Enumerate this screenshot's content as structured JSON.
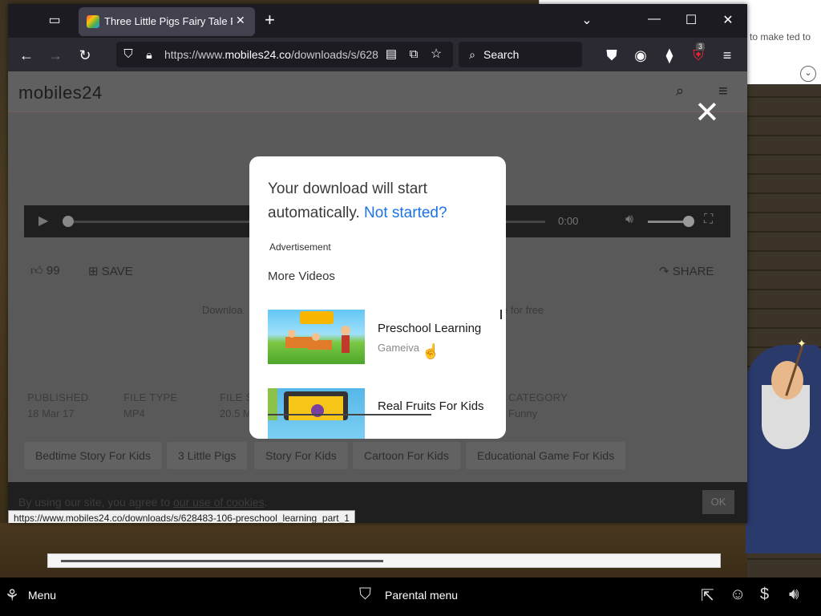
{
  "browser": {
    "tab_title": "Three Little Pigs Fairy Tale Free",
    "url_prefix": "https://www.",
    "url_domain": "mobiles24.co",
    "url_path": "/downloads/s/628",
    "search_placeholder": "Search",
    "extension_badge": "3"
  },
  "notification": {
    "text": "to make ted to"
  },
  "site": {
    "logo": "mobiles24",
    "player_time": "0:00",
    "likes": "99",
    "save_label": "SAVE",
    "share_label": "SHARE",
    "download_left": "Downloa",
    "download_right": "e for free",
    "meta": [
      {
        "key": "PUBLISHED",
        "value": "18 Mar 17"
      },
      {
        "key": "FILE TYPE",
        "value": "MP4"
      },
      {
        "key": "FILE S",
        "value": "20.5 M"
      },
      {
        "key": "CATEGORY",
        "value": "Funny"
      }
    ],
    "tags": [
      "Bedtime Story For Kids",
      "3 Little Pigs",
      "Story For Kids",
      "Cartoon For Kids",
      "Educational Game For Kids"
    ],
    "cookie_text": "By using our site, you agree to ",
    "cookie_link": "our use of cookies",
    "cookie_suffix": ".",
    "cookie_ok": "OK",
    "status_url": "https://www.mobiles24.co/downloads/s/628483-106-preschool_learning_part_1"
  },
  "modal": {
    "message": "Your download will start automatically.",
    "link": "Not started?",
    "ad_label": "Advertisement",
    "more_videos": "More Videos",
    "videos": [
      {
        "title": "Preschool Learning",
        "channel": "Gameiva"
      },
      {
        "title": "Real Fruits For Kids",
        "channel": ""
      }
    ]
  },
  "taskbar": {
    "menu": "Menu",
    "parental": "Parental menu"
  },
  "colors": {
    "link": "#1a73e8",
    "browser_bg": "#2b2a33",
    "tab_active": "#42414d"
  }
}
